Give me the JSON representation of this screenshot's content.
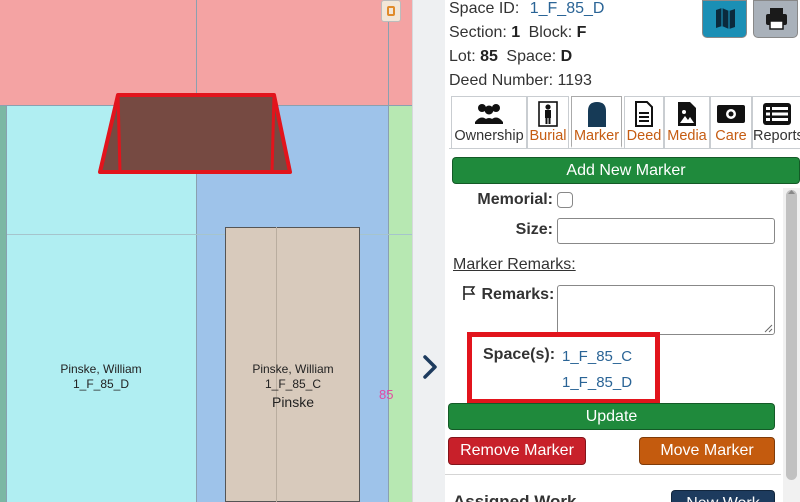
{
  "map": {
    "plots": [
      {
        "name": "Pinske, William",
        "space": "1_F_85_D",
        "sub": ""
      },
      {
        "name": "Pinske, William",
        "space": "1_F_85_C",
        "sub": "Pinske"
      }
    ],
    "lot_number": "85"
  },
  "info": {
    "space_id_label": "Space ID:",
    "space_id_value": "1_F_85_D",
    "section_label": "Section:",
    "section_value": "1",
    "block_label": "Block:",
    "block_value": "F",
    "lot_label": "Lot:",
    "lot_value": "85",
    "space_label": "Space:",
    "space_value": "D",
    "deed_label": "Deed Number:",
    "deed_value": "1193"
  },
  "top_buttons": {
    "map_icon": "map-icon",
    "print_icon": "printer-icon"
  },
  "tabs": [
    {
      "label": "Ownership",
      "icon": "users-icon",
      "color": "#333"
    },
    {
      "label": "Burial",
      "icon": "person-icon",
      "color": "#c55c12"
    },
    {
      "label": "Marker",
      "icon": "headstone-icon",
      "color": "#c55c12",
      "active": true
    },
    {
      "label": "Deed",
      "icon": "document-icon",
      "color": "#c55c12"
    },
    {
      "label": "Media",
      "icon": "image-file-icon",
      "color": "#c55c12"
    },
    {
      "label": "Care",
      "icon": "money-icon",
      "color": "#c55c12"
    },
    {
      "label": "Reports",
      "icon": "list-icon",
      "color": "#333"
    }
  ],
  "marker": {
    "add_button": "Add New Marker",
    "memorial_label": "Memorial:",
    "size_label": "Size:",
    "size_value": "",
    "remarks_heading": "Marker Remarks:",
    "remarks_label": "Remarks:",
    "remarks_value": "",
    "spaces_label": "Space(s):",
    "spaces": [
      "1_F_85_C",
      "1_F_85_D"
    ],
    "update_button": "Update",
    "remove_button": "Remove Marker",
    "move_button": "Move Marker"
  },
  "bottom": {
    "section_heading": "Assigned Work",
    "new_button": "New Work"
  },
  "colors": {
    "accent_green": "#1f8a3c",
    "danger_red": "#c8202a",
    "warning_orange": "#c45b0e",
    "map_button_blue": "#1b8fb5",
    "highlight_red": "#e2141c"
  }
}
